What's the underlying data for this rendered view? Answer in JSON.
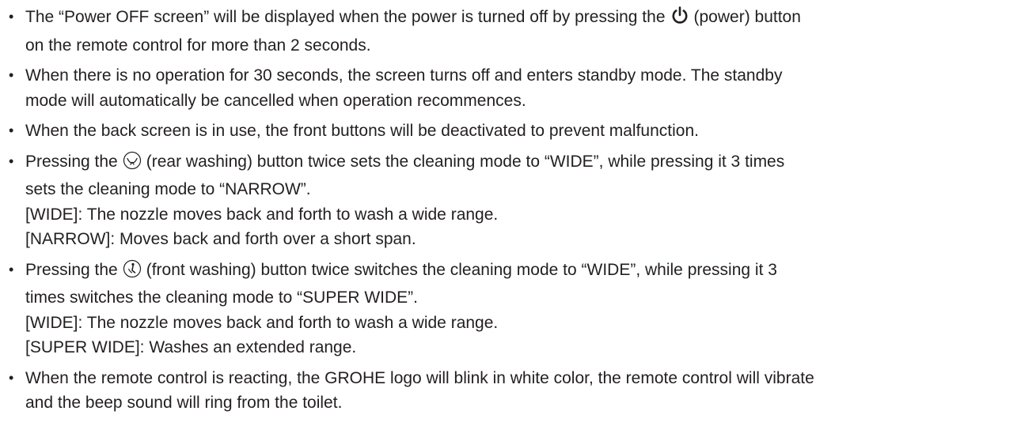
{
  "items": [
    {
      "lines": [
        {
          "pre": "The “Power OFF screen” will be displayed when the power is turned off by pressing the",
          "icon": "power-icon",
          "post": "(power) button"
        },
        {
          "text": "on the remote control for more than 2 seconds."
        }
      ]
    },
    {
      "lines": [
        {
          "text": "When there is no operation for 30 seconds, the screen turns off and enters standby mode. The standby"
        },
        {
          "text": "mode will automatically be cancelled when operation recommences."
        }
      ]
    },
    {
      "lines": [
        {
          "text": "When the back screen is in use, the front buttons will be deactivated to prevent malfunction."
        }
      ]
    },
    {
      "lines": [
        {
          "pre": "Pressing the",
          "icon": "rear-washing-icon",
          "post": "(rear washing) button twice sets the cleaning mode to “WIDE”, while pressing it 3 times"
        },
        {
          "text": "sets the cleaning mode to “NARROW”."
        },
        {
          "text": "[WIDE]: The nozzle moves back and forth to wash a wide range."
        },
        {
          "text": "[NARROW]: Moves back and forth over a short span."
        }
      ]
    },
    {
      "lines": [
        {
          "pre": "Pressing the",
          "icon": "front-washing-icon",
          "post": "(front washing) button twice switches the cleaning mode to “WIDE”, while pressing it 3"
        },
        {
          "text": "times switches the cleaning mode to “SUPER WIDE”."
        },
        {
          "text": "[WIDE]: The nozzle moves back and forth to wash a wide range."
        },
        {
          "text": "[SUPER WIDE]: Washes an extended range."
        }
      ]
    },
    {
      "lines": [
        {
          "text": "When the remote control is reacting, the GROHE logo will blink in white color, the remote control will vibrate"
        },
        {
          "text": "and the beep sound will ring from the toilet."
        }
      ]
    }
  ]
}
